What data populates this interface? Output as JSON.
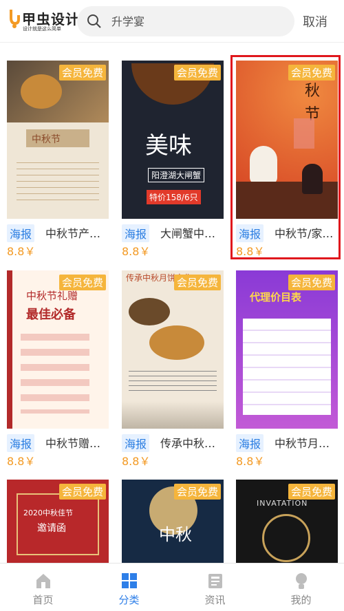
{
  "header": {
    "logo_text": "甲虫设计",
    "logo_tagline": "设计就是这么简单",
    "search_placeholder": "升学宴",
    "cancel_label": "取消"
  },
  "cards": [
    {
      "badge": "会员免费",
      "tag": "海报",
      "title": "中秋节产品促销",
      "price": "8.8￥",
      "thumb_text": "中秋节"
    },
    {
      "badge": "会员免费",
      "tag": "海报",
      "title": "大闸蟹中秋促销",
      "price": "8.8￥",
      "thumb_text": "美味",
      "thumb_sub": "阳澄湖大闸蟹",
      "thumb_price": "特价158/6只"
    },
    {
      "badge": "会员免费",
      "tag": "海报",
      "title": "中秋节/家人团聚",
      "price": "8.8￥",
      "thumb_text": "秋",
      "thumb_text2": "节"
    },
    {
      "badge": "会员免费",
      "tag": "海报",
      "title": "中秋节赠礼必备",
      "price": "8.8￥",
      "thumb_text": "中秋节礼赠",
      "thumb_sub": "最佳必备"
    },
    {
      "badge": "会员免费",
      "tag": "海报",
      "title": "传承中秋月饼文化",
      "price": "8.8￥",
      "thumb_text": "传承中秋月饼文化"
    },
    {
      "badge": "会员免费",
      "tag": "海报",
      "title": "中秋节月饼价目表",
      "price": "8.8￥",
      "thumb_text": "代理价目表"
    },
    {
      "badge": "会员免费",
      "thumb_text": "2020中秋佳节",
      "thumb_sub": "邀请函"
    },
    {
      "badge": "会员免费",
      "thumb_text": "中秋"
    },
    {
      "badge": "会员免费",
      "thumb_text": "INVATATION"
    }
  ],
  "nav": [
    {
      "label": "首页",
      "icon": "home-icon"
    },
    {
      "label": "分类",
      "icon": "grid-icon"
    },
    {
      "label": "资讯",
      "icon": "news-icon"
    },
    {
      "label": "我的",
      "icon": "profile-icon"
    }
  ],
  "colors": {
    "badge": "#f5b53c",
    "tag_text": "#2a7de1",
    "price": "#f39a24",
    "active_nav": "#2e7fe8",
    "selection": "#e0171d"
  }
}
